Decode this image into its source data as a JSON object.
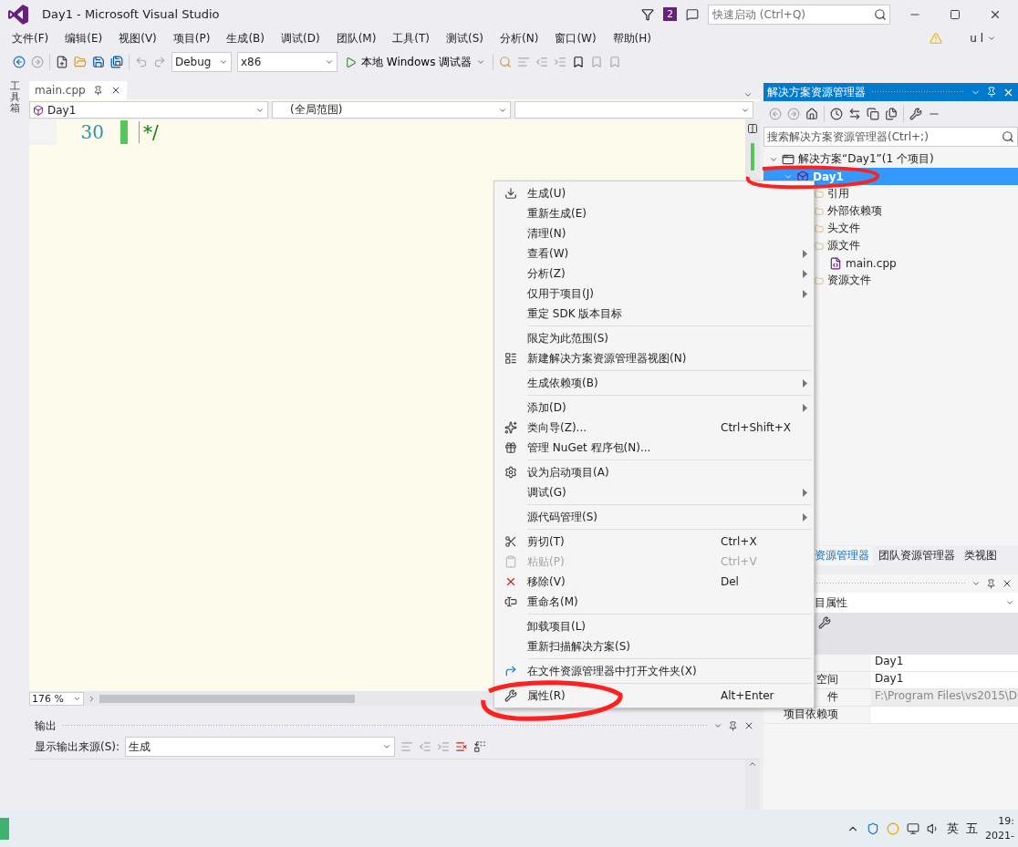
{
  "window": {
    "title": "Day1 - Microsoft Visual Studio",
    "notification_count": "2",
    "quick_launch": {
      "placeholder": "快速启动 (Ctrl+Q)"
    },
    "user": "u l"
  },
  "menu_bar": [
    "文件(F)",
    "编辑(E)",
    "视图(V)",
    "项目(P)",
    "生成(B)",
    "调试(D)",
    "团队(M)",
    "工具(T)",
    "测试(S)",
    "分析(N)",
    "窗口(W)",
    "帮助(H)"
  ],
  "toolbar": {
    "configuration": "Debug",
    "platform": "x86",
    "run_button": "本地 Windows 调试器"
  },
  "toolbox_strip": "工具箱",
  "document_tab": {
    "label": "main.cpp"
  },
  "navigation_bar": {
    "project": "Day1",
    "scope": "(全局范围)"
  },
  "editor": {
    "line_number": "30",
    "code": "*/",
    "zoom": "176 %"
  },
  "solution_explorer": {
    "title": "解决方案资源管理器",
    "search": {
      "placeholder": "搜索解决方案资源管理器(Ctrl+;)"
    },
    "tree": [
      {
        "label": "解决方案“Day1”(1 个项目)",
        "kind": "solution",
        "selected": false,
        "expanded": true,
        "children": [
          {
            "label": "Day1",
            "kind": "project",
            "selected": true,
            "expanded": true,
            "children": [
              {
                "label": "引用",
                "kind": "folder",
                "selected": false
              },
              {
                "label": "外部依赖项",
                "kind": "folder",
                "selected": false
              },
              {
                "label": "头文件",
                "kind": "folder",
                "selected": false
              },
              {
                "label": "源文件",
                "kind": "folder",
                "selected": false,
                "children": [
                  {
                    "label": "main.cpp",
                    "kind": "file",
                    "selected": false
                  }
                ]
              },
              {
                "label": "资源文件",
                "kind": "folder",
                "selected": false
              }
            ]
          }
        ]
      }
    ]
  },
  "panel_tabs": [
    {
      "label": "资源管理器",
      "selected": true
    },
    {
      "label": "团队资源管理器",
      "selected": false
    },
    {
      "label": "类视图",
      "selected": false
    }
  ],
  "properties": {
    "object": "目属性",
    "rows": [
      {
        "name": "",
        "value": "Day1",
        "disabled": false
      },
      {
        "name": "空间",
        "value": "Day1",
        "disabled": false
      },
      {
        "name": "件",
        "value": "F:\\Program Files\\vs2015\\D",
        "disabled": true
      },
      {
        "name": "项目依赖项",
        "value": "",
        "disabled": false
      }
    ]
  },
  "output": {
    "title": "输出",
    "source_label": "显示输出来源(S):",
    "source": "生成"
  },
  "context_menu": [
    {
      "kind": "item",
      "label": "生成(U)",
      "submenu": false,
      "disabled": false
    },
    {
      "kind": "item",
      "label": "重新生成(E)",
      "submenu": false,
      "disabled": false
    },
    {
      "kind": "item",
      "label": "清理(N)",
      "submenu": false,
      "disabled": false
    },
    {
      "kind": "item",
      "label": "查看(W)",
      "submenu": true,
      "disabled": false
    },
    {
      "kind": "item",
      "label": "分析(Z)",
      "submenu": true,
      "disabled": false
    },
    {
      "kind": "item",
      "label": "仅用于项目(J)",
      "submenu": true,
      "disabled": false
    },
    {
      "kind": "item",
      "label": "重定 SDK 版本目标",
      "submenu": false,
      "disabled": false
    },
    {
      "kind": "separator"
    },
    {
      "kind": "item",
      "label": "限定为此范围(S)",
      "submenu": false,
      "disabled": false
    },
    {
      "kind": "item",
      "label": "新建解决方案资源管理器视图(N)",
      "submenu": false,
      "disabled": false
    },
    {
      "kind": "separator"
    },
    {
      "kind": "item",
      "label": "生成依赖项(B)",
      "submenu": true,
      "disabled": false
    },
    {
      "kind": "separator"
    },
    {
      "kind": "item",
      "label": "添加(D)",
      "submenu": true,
      "disabled": false
    },
    {
      "kind": "item",
      "label": "类向导(Z)...",
      "shortcut": "Ctrl+Shift+X",
      "submenu": false,
      "disabled": false
    },
    {
      "kind": "item",
      "label": "管理 NuGet 程序包(N)...",
      "submenu": false,
      "disabled": false
    },
    {
      "kind": "separator"
    },
    {
      "kind": "item",
      "label": "设为启动项目(A)",
      "submenu": false,
      "disabled": false
    },
    {
      "kind": "item",
      "label": "调试(G)",
      "submenu": true,
      "disabled": false
    },
    {
      "kind": "separator"
    },
    {
      "kind": "item",
      "label": "源代码管理(S)",
      "submenu": true,
      "disabled": false
    },
    {
      "kind": "separator"
    },
    {
      "kind": "item",
      "label": "剪切(T)",
      "shortcut": "Ctrl+X",
      "submenu": false,
      "disabled": false
    },
    {
      "kind": "item",
      "label": "粘贴(P)",
      "shortcut": "Ctrl+V",
      "submenu": false,
      "disabled": true
    },
    {
      "kind": "item",
      "label": "移除(V)",
      "shortcut": "Del",
      "submenu": false,
      "disabled": false
    },
    {
      "kind": "item",
      "label": "重命名(M)",
      "submenu": false,
      "disabled": false
    },
    {
      "kind": "separator"
    },
    {
      "kind": "item",
      "label": "卸载项目(L)",
      "submenu": false,
      "disabled": false
    },
    {
      "kind": "item",
      "label": "重新扫描解决方案(S)",
      "submenu": false,
      "disabled": false
    },
    {
      "kind": "separator"
    },
    {
      "kind": "item",
      "label": "在文件资源管理器中打开文件夹(X)",
      "submenu": false,
      "disabled": false
    },
    {
      "kind": "separator"
    },
    {
      "kind": "item",
      "label": "属性(R)",
      "shortcut": "Alt+Enter",
      "submenu": false,
      "disabled": false
    }
  ],
  "taskbar": {
    "input_language": "英",
    "input_method": "五",
    "time": "19:",
    "date": "2021-"
  }
}
